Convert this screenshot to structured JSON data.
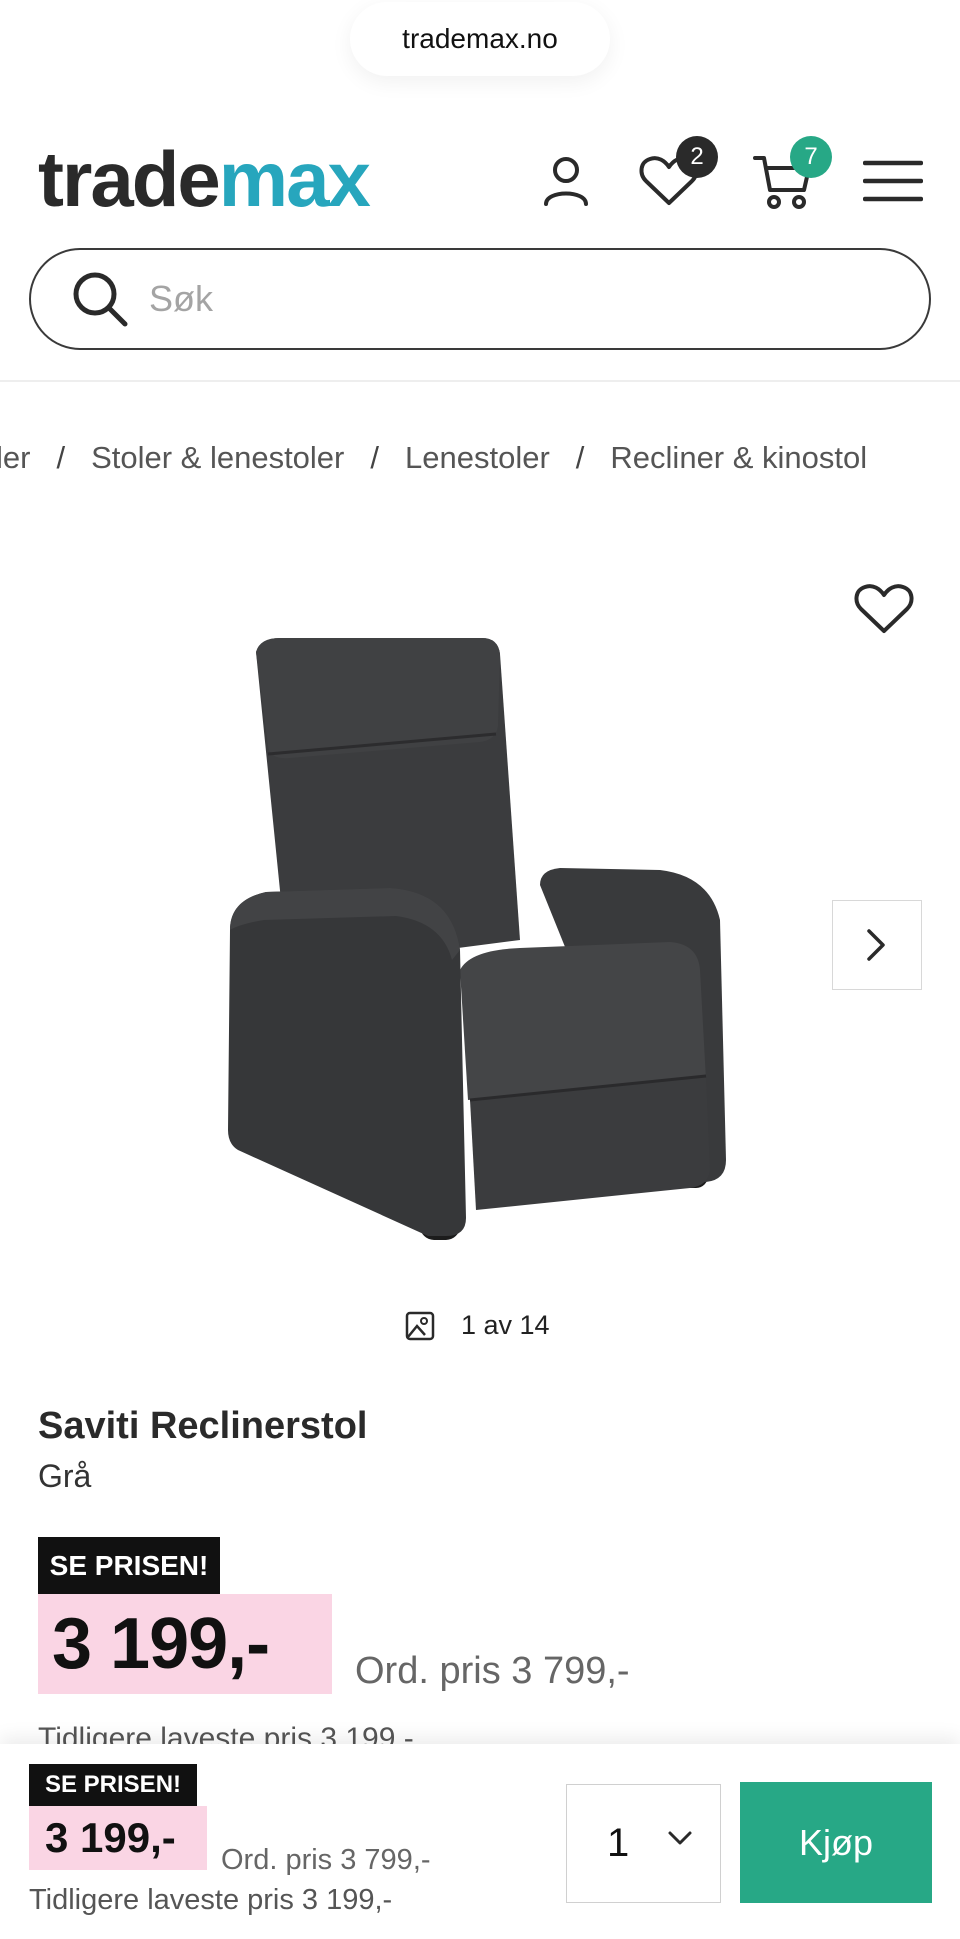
{
  "browser": {
    "url": "trademax.no"
  },
  "header": {
    "logo_part1": "trade",
    "logo_part2": "max",
    "wishlist_count": "2",
    "cart_count": "7",
    "accent_color": "#27a6bd",
    "cart_badge_color": "#27a886"
  },
  "search": {
    "placeholder": "Søk",
    "value": ""
  },
  "breadcrumb": [
    "ler",
    "Stoler & lenestoler",
    "Lenestoler",
    "Recliner & kinostol"
  ],
  "gallery": {
    "counter": "1 av 14",
    "icons": [
      "heart-icon",
      "chevron-right-icon",
      "image-icon"
    ]
  },
  "product": {
    "name": "Saviti Reclinerstol",
    "variant": "Grå",
    "promo_tag": "SE PRISEN!",
    "price": "3 199,-",
    "ordinary_price": "Ord. pris 3 799,-",
    "lowest_price": "Tidligere laveste pris 3 199,-",
    "price_highlight_color": "#fad5e4"
  },
  "sticky_bar": {
    "promo_tag": "SE PRISEN!",
    "price": "3 199,-",
    "ordinary_price": "Ord. pris 3 799,-",
    "lowest_price": "Tidligere laveste pris 3 199,-",
    "quantity": "1",
    "buy_label": "Kjøp",
    "buy_color": "#27a886"
  }
}
